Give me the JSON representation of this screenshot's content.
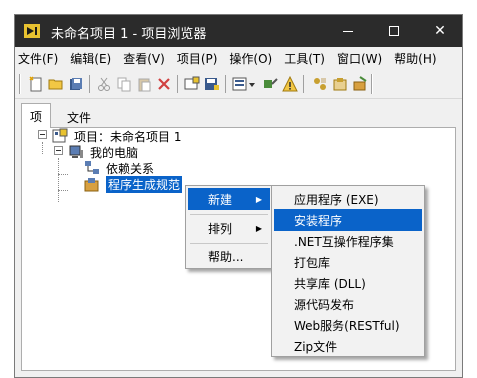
{
  "window": {
    "title": "未命名项目 1 - 项目浏览器"
  },
  "menubar": [
    "文件(F)",
    "编辑(E)",
    "查看(V)",
    "项目(P)",
    "操作(O)",
    "工具(T)",
    "窗口(W)",
    "帮助(H)"
  ],
  "tabs": [
    "项",
    "文件"
  ],
  "tree": {
    "project": "项目：未命名项目 1",
    "computer": "我的电脑",
    "dependencies": "依赖关系",
    "build_specs": "程序生成规范"
  },
  "context_menu": {
    "items": [
      "新建",
      "排列",
      "帮助..."
    ]
  },
  "submenu": {
    "items": [
      "应用程序 (EXE)",
      "安装程序",
      ".NET互操作程序集",
      "打包库",
      "共享库 (DLL)",
      "源代码发布",
      "Web服务(RESTful)",
      "Zip文件"
    ],
    "highlighted": "安装程序"
  },
  "colors": {
    "titlebar": "#2b2b2b",
    "selection": "#0a63c9"
  }
}
